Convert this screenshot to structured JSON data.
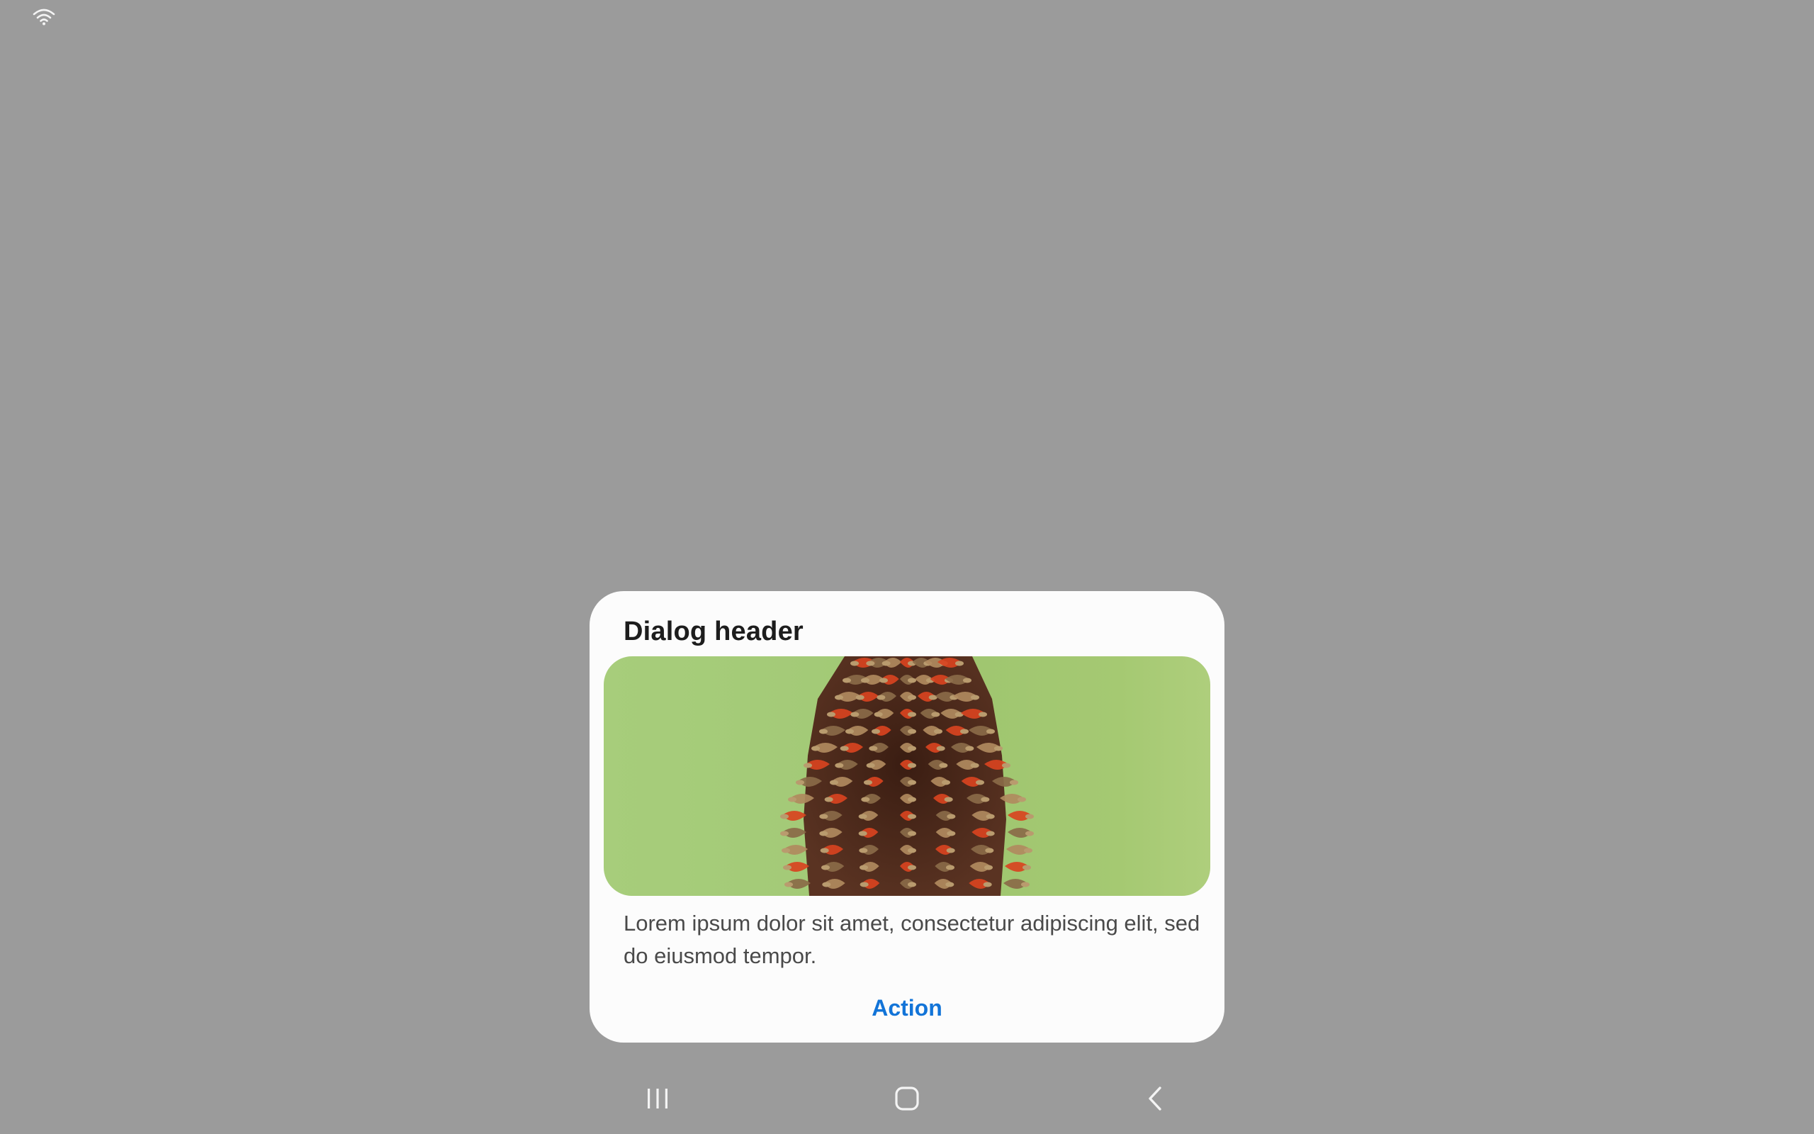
{
  "status_bar": {
    "wifi_icon": "wifi-icon",
    "icon_color": "#f5f5f5"
  },
  "dialog": {
    "title": "Dialog header",
    "image_alt_icon": "pinecone-image",
    "body": "Lorem ipsum dolor sit amet, consectetur adipiscing elit, sed do eiusmod tempor.",
    "action_label": "Action",
    "action_color": "#1274d8",
    "background": "#fcfcfc"
  },
  "nav_bar": {
    "recents_icon": "recents-icon",
    "home_icon": "home-icon",
    "back_icon": "back-icon",
    "icon_color": "#f5f5f5"
  },
  "backdrop_color": "#9b9b9b"
}
